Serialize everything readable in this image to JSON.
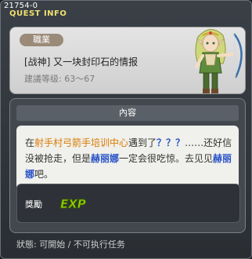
{
  "window": {
    "quest_id": "21754-0",
    "title": "QUEST INFO"
  },
  "info": {
    "job_tag": "職業",
    "quest_name": "[战神] 又一块封印石的情报",
    "required_level": "建議等级: 63～67"
  },
  "content": {
    "header": "內容",
    "description": {
      "part1": "在",
      "place": "射手村弓箭手培训中心",
      "part2": "遇到了",
      "unknown": "？？？",
      "part3": "……还好信没被抢走，但是",
      "npc1": "赫丽娜",
      "part4": "一定会很吃惊。去见见",
      "npc2": "赫丽娜",
      "part5": "吧。"
    }
  },
  "reward": {
    "label": "獎勵",
    "exp_icon_text": "EXP"
  },
  "status": {
    "text": "狀態:  可開始 / 不可执行任务"
  },
  "colors": {
    "title": "#f0e070",
    "place_highlight": "#d87a00",
    "npc_highlight": "#2b54c8",
    "exp": "#8fd400"
  },
  "icons": {
    "npc_portrait": "archer-npc-portrait",
    "exp": "exp-icon"
  }
}
